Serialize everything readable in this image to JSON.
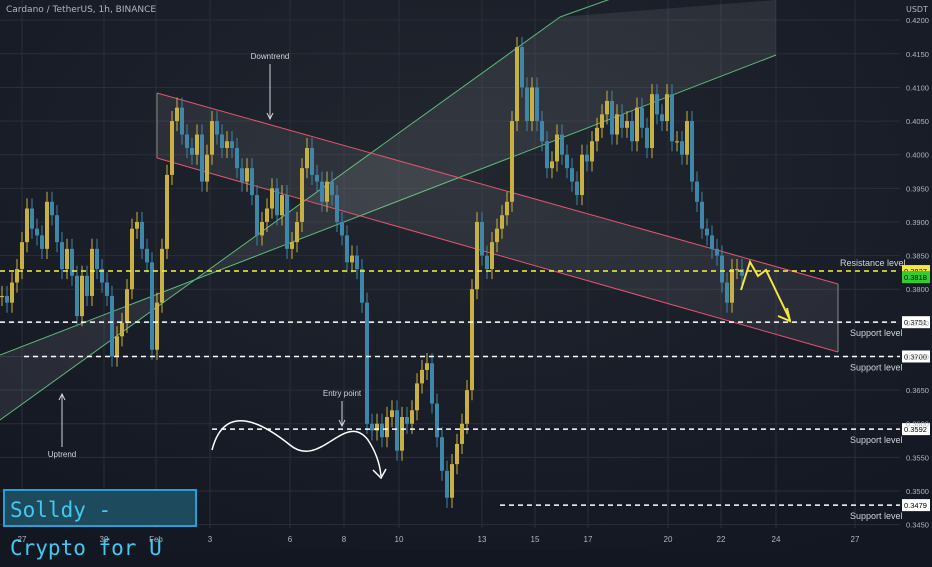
{
  "header": {
    "title": "Cardano / TetherUS, 1h, BINANCE",
    "currency": "USDT"
  },
  "brand": {
    "label": "Solldy - Crypto for U"
  },
  "colors": {
    "background": "#131722",
    "bull": "#c8b042",
    "bear": "#3f86a8",
    "uptrend_channel": "#5fb878",
    "downtrend_channel": "#e0566e",
    "dashed_level": "#ffffff",
    "resistance_dashed": "#f5f542",
    "current_price_box": "#33cc33",
    "resistance_box": "#f5e642"
  },
  "chart_data": {
    "type": "line",
    "title": "Cardano / TetherUS, 1h, BINANCE",
    "xlabel": "",
    "ylabel": "",
    "ylim": [
      0.3445,
      0.423
    ],
    "x_ticks": [
      "27",
      "30",
      "Feb",
      "3",
      "6",
      "8",
      "10",
      "13",
      "15",
      "17",
      "20",
      "22",
      "24",
      "27"
    ],
    "y_ticks": [
      0.42,
      0.415,
      0.41,
      0.405,
      0.4,
      0.395,
      0.39,
      0.385,
      0.38,
      0.375,
      0.37,
      0.365,
      0.36,
      0.355,
      0.35,
      0.345
    ],
    "y_tick_labels": [
      "0.4200",
      "0.4150",
      "0.4100",
      "0.4050",
      "0.4000",
      "0.3950",
      "0.3900",
      "0.3850",
      "0.3800",
      "0.3750",
      "0.3700",
      "0.3650",
      "0.3600",
      "0.3550",
      "0.3500",
      "0.3450"
    ],
    "series": [
      {
        "values": [
          0.379,
          0.378,
          0.381,
          0.383,
          0.387,
          0.392,
          0.389,
          0.388,
          0.386,
          0.393,
          0.391,
          0.387,
          0.383,
          0.386,
          0.382,
          0.376,
          0.382,
          0.379,
          0.386,
          0.383,
          0.381,
          0.379,
          0.37,
          0.373,
          0.375,
          0.38,
          0.389,
          0.39,
          0.386,
          0.384,
          0.371,
          0.378,
          0.386,
          0.397,
          0.405,
          0.407,
          0.403,
          0.401,
          0.4,
          0.403,
          0.396,
          0.4,
          0.405,
          0.403,
          0.401,
          0.402,
          0.401,
          0.398,
          0.396,
          0.398,
          0.394,
          0.388,
          0.39,
          0.392,
          0.395,
          0.391,
          0.394,
          0.386,
          0.387,
          0.39,
          0.398,
          0.401,
          0.397,
          0.396,
          0.393,
          0.396,
          0.394,
          0.39,
          0.388,
          0.384,
          0.385,
          0.383,
          0.378,
          0.36,
          0.359,
          0.36,
          0.358,
          0.361,
          0.362,
          0.356,
          0.361,
          0.36,
          0.362,
          0.366,
          0.368,
          0.369,
          0.363,
          0.358,
          0.353,
          0.349,
          0.354,
          0.357,
          0.36,
          0.365,
          0.38,
          0.39,
          0.385,
          0.383,
          0.387,
          0.389,
          0.391,
          0.393,
          0.405,
          0.416,
          0.41,
          0.405,
          0.41,
          0.405,
          0.402,
          0.398,
          0.399,
          0.403,
          0.4,
          0.398,
          0.396,
          0.394,
          0.4,
          0.399,
          0.402,
          0.404,
          0.406,
          0.408,
          0.403,
          0.406,
          0.404,
          0.405,
          0.402,
          0.407,
          0.404,
          0.401,
          0.409,
          0.406,
          0.405,
          0.409,
          0.402,
          0.402,
          0.4,
          0.405,
          0.396,
          0.393,
          0.389,
          0.388,
          0.386,
          0.385,
          0.381,
          0.378,
          0.383,
          0.383,
          0.382
        ]
      }
    ],
    "annotations": [
      {
        "label": "Downtrend"
      },
      {
        "label": "Uptrend"
      },
      {
        "label": "Entry point"
      }
    ],
    "levels": [
      {
        "label": "Resistance level",
        "value": 0.3827,
        "price_label": "0.3827"
      },
      {
        "label": "Support level",
        "value": 0.3751,
        "price_label": "0.3751"
      },
      {
        "label": "Support level",
        "value": 0.37,
        "price_label": "0.3700"
      },
      {
        "label": "Support level",
        "value": 0.3592,
        "price_label": "0.3592"
      },
      {
        "label": "Support level",
        "value": 0.3479,
        "price_label": "0.3479"
      }
    ],
    "current_price": {
      "value": 0.3818,
      "label": "0.3818"
    },
    "grid": true,
    "legend": "none"
  }
}
